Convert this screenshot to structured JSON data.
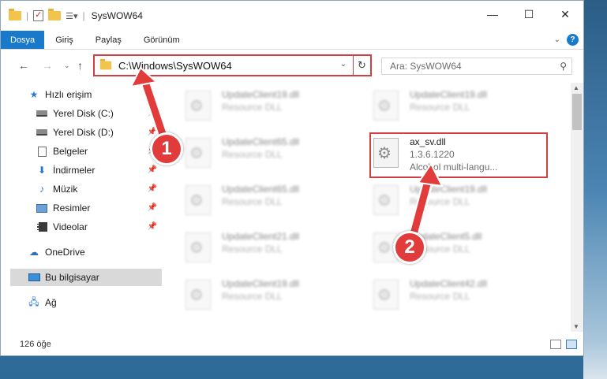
{
  "window": {
    "title": "SysWOW64",
    "controls": {
      "minimize": "—",
      "maximize": "☐",
      "close": "✕"
    }
  },
  "ribbon": {
    "tabs": [
      "Dosya",
      "Giriş",
      "Paylaş",
      "Görünüm"
    ],
    "help_label": "?"
  },
  "address": {
    "path": "C:\\Windows\\SysWOW64",
    "search_placeholder": "Ara: SysWOW64"
  },
  "sidebar": {
    "items": [
      {
        "label": "Hızlı erişim",
        "icon": "star-icon",
        "pinned": false
      },
      {
        "label": "Yerel Disk (C:)",
        "icon": "drive-icon",
        "pinned": true
      },
      {
        "label": "Yerel Disk (D:)",
        "icon": "drive-icon",
        "pinned": true
      },
      {
        "label": "Belgeler",
        "icon": "document-icon",
        "pinned": true
      },
      {
        "label": "İndirmeler",
        "icon": "download-icon",
        "pinned": true
      },
      {
        "label": "Müzik",
        "icon": "music-icon",
        "pinned": true
      },
      {
        "label": "Resimler",
        "icon": "pictures-icon",
        "pinned": true
      },
      {
        "label": "Videolar",
        "icon": "video-icon",
        "pinned": true
      },
      {
        "label": "OneDrive",
        "icon": "cloud-icon",
        "pinned": false
      },
      {
        "label": "Bu bilgisayar",
        "icon": "computer-icon",
        "pinned": false
      },
      {
        "label": "Ağ",
        "icon": "network-icon",
        "pinned": false
      }
    ]
  },
  "files": [
    {
      "name": "UpdateClient19.dll",
      "type": "Resource DLL"
    },
    {
      "name": "UpdateClient19.dll",
      "type": "Resource DLL"
    },
    {
      "name": "UpdateClient65.dll",
      "type": "Resource DLL"
    },
    {
      "name": "ax_sv.dll",
      "version": "1.3.6.1220",
      "description": "Alcohol multi-langu..."
    },
    {
      "name": "UpdateClient65.dll",
      "type": "Resource DLL"
    },
    {
      "name": "UpdateClient19.dll",
      "type": "Resource DLL"
    },
    {
      "name": "UpdateClient21.dll",
      "type": "Resource DLL"
    },
    {
      "name": "UpdateClient5.dll",
      "type": "Resource DLL"
    },
    {
      "name": "UpdateClient19.dll",
      "type": "Resource DLL"
    },
    {
      "name": "UpdateClient42.dll",
      "type": "Resource DLL"
    }
  ],
  "status": {
    "item_count": "126 öğe"
  },
  "annotations": {
    "badge1": "1",
    "badge2": "2",
    "accent_color": "#e23b3b"
  }
}
